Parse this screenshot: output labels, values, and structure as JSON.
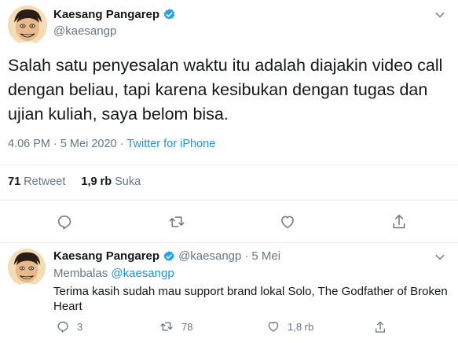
{
  "tweet": {
    "author_name": "Kaesang Pangarep",
    "author_handle": "@kaesangp",
    "text": "Salah satu penyesalan waktu itu adalah diajakin video call dengan beliau, tapi karena kesibukan dengan tugas dan ujian kuliah, saya belom bisa.",
    "time": "4.06 PM",
    "separator": "·",
    "date": "5 Mei 2020",
    "source": "Twitter for iPhone",
    "retweet_count": "71",
    "retweet_label": "Retweet",
    "like_count": "1,9 rb",
    "like_label": "Suka"
  },
  "reply": {
    "author_name": "Kaesang Pangarep",
    "author_handle": "@kaesangp",
    "separator": "·",
    "date": "5 Mei",
    "replying_label": "Membalas",
    "replying_to": "@kaesangp",
    "text": "Terima kasih sudah mau support brand lokal Solo, The Godfather of Broken Heart",
    "reply_count": "3",
    "retweet_count": "78",
    "like_count": "1,8 rb"
  },
  "colors": {
    "accent": "#1b95e0",
    "muted": "#657786",
    "verified": "#1da1f2",
    "divider": "#e6ecf0"
  },
  "icons": [
    "verified-badge-icon",
    "chevron-down-icon",
    "reply-icon",
    "retweet-icon",
    "like-icon",
    "share-icon"
  ]
}
